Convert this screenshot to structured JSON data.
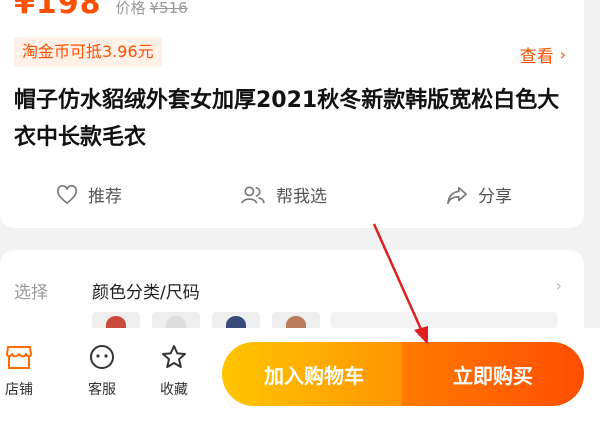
{
  "product": {
    "price": "¥198",
    "original_price_label": "价格",
    "original_price": "¥516",
    "coin_offer": "淘金币可抵3.96元",
    "view_link": "查看",
    "title": "帽子仿水貂绒外套女加厚2021秋冬新款韩版宽松白色大衣中长款毛衣"
  },
  "actions": {
    "recommend": "推荐",
    "help_choose": "帮我选",
    "share": "分享"
  },
  "sku": {
    "label": "选择",
    "value": "颜色分类/尺码",
    "thumb_colors": [
      "#c94a3a",
      "#dcdcdc",
      "#3a4a7a",
      "#b87a5a"
    ]
  },
  "bottom_bar": {
    "store": "店铺",
    "service": "客服",
    "favorite": "收藏",
    "add_to_cart": "加入购物车",
    "buy_now": "立即购买"
  },
  "colors": {
    "accent": "#ff5000",
    "annotation_arrow": "#e02020"
  }
}
